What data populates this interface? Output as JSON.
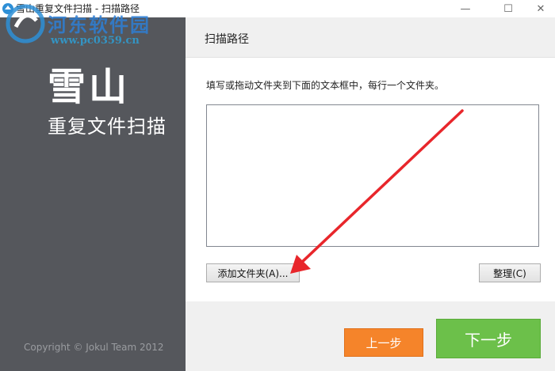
{
  "window": {
    "title": "雪山重复文件扫描 - 扫描路径",
    "minimize_glyph": "—",
    "maximize_glyph": "☐",
    "close_glyph": "✕"
  },
  "watermark": {
    "text": "河东软件园",
    "url": "www.pc0359.cn"
  },
  "sidebar": {
    "brand_main": "雪山",
    "brand_sub": "重复文件扫描",
    "copyright": "Copyright © Jokul Team 2012"
  },
  "header": {
    "title": "扫描路径"
  },
  "content": {
    "instruction": "填写或拖动文件夹到下面的文本框中，每行一个文件夹。",
    "path_value": "",
    "add_folder_label": "添加文件夹(A)...",
    "tidy_label": "整理(C)"
  },
  "footer": {
    "prev_label": "上一步",
    "next_label": "下一步"
  },
  "colors": {
    "sidebar_bg": "#55575c",
    "prev_button": "#f5842a",
    "next_button": "#6cc04a",
    "annotation_arrow": "#e8262b"
  },
  "icons": {
    "app": "app-logo-icon",
    "minimize": "minimize-icon",
    "maximize": "maximize-icon",
    "close": "close-icon"
  }
}
